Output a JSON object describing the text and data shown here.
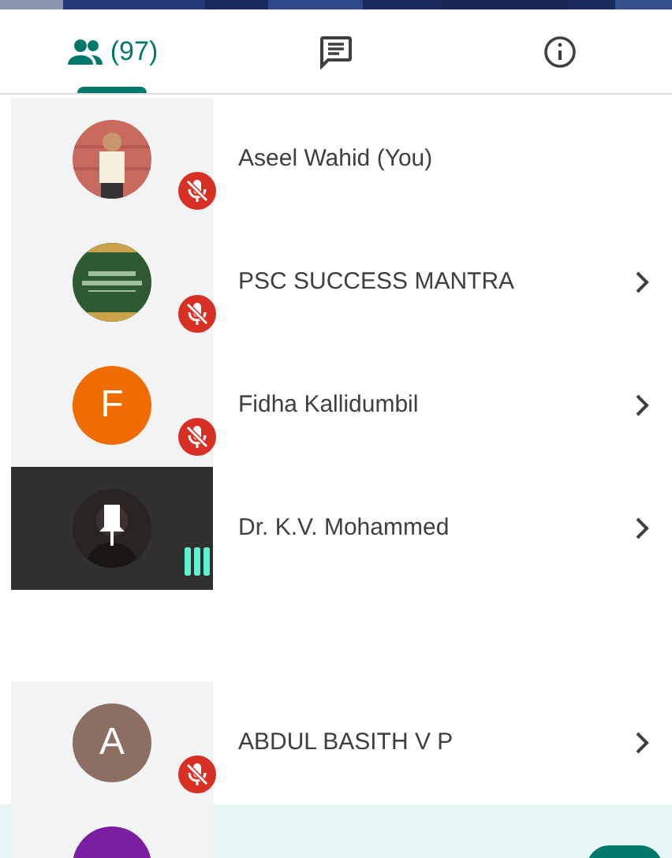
{
  "tabs": [
    {
      "kind": "people",
      "label": "(97)",
      "selected": true
    },
    {
      "kind": "chat",
      "selected": false
    },
    {
      "kind": "info",
      "selected": false
    }
  ],
  "participants": [
    {
      "name": "Aseel Wahid (You)",
      "muted": true,
      "speaking": false,
      "chevron": false,
      "pinned": false,
      "selected": false
    },
    {
      "name": "PSC SUCCESS MANTRA",
      "muted": true,
      "speaking": false,
      "chevron": true,
      "pinned": false,
      "selected": false
    },
    {
      "name": "Fidha Kallidumbil",
      "avatar": {
        "kind": "initial",
        "letter": "F",
        "color": "#ef6c00"
      },
      "muted": true,
      "speaking": false,
      "chevron": true,
      "pinned": false,
      "selected": false
    },
    {
      "name": "Dr. K.V. Mohammed",
      "muted": false,
      "speaking": true,
      "chevron": true,
      "pinned": true,
      "selected": false
    },
    {
      "kind": "gap"
    },
    {
      "name": "ABDUL BASITH V P",
      "avatar": {
        "kind": "initial",
        "letter": "A",
        "color": "#8d6e63"
      },
      "muted": true,
      "speaking": false,
      "chevron": true,
      "pinned": false,
      "selected": false
    },
    {
      "avatar": {
        "kind": "circle",
        "color": "#7b1fa2"
      },
      "chevron": false,
      "pinned": false,
      "selected": true,
      "action_button": true
    }
  ]
}
